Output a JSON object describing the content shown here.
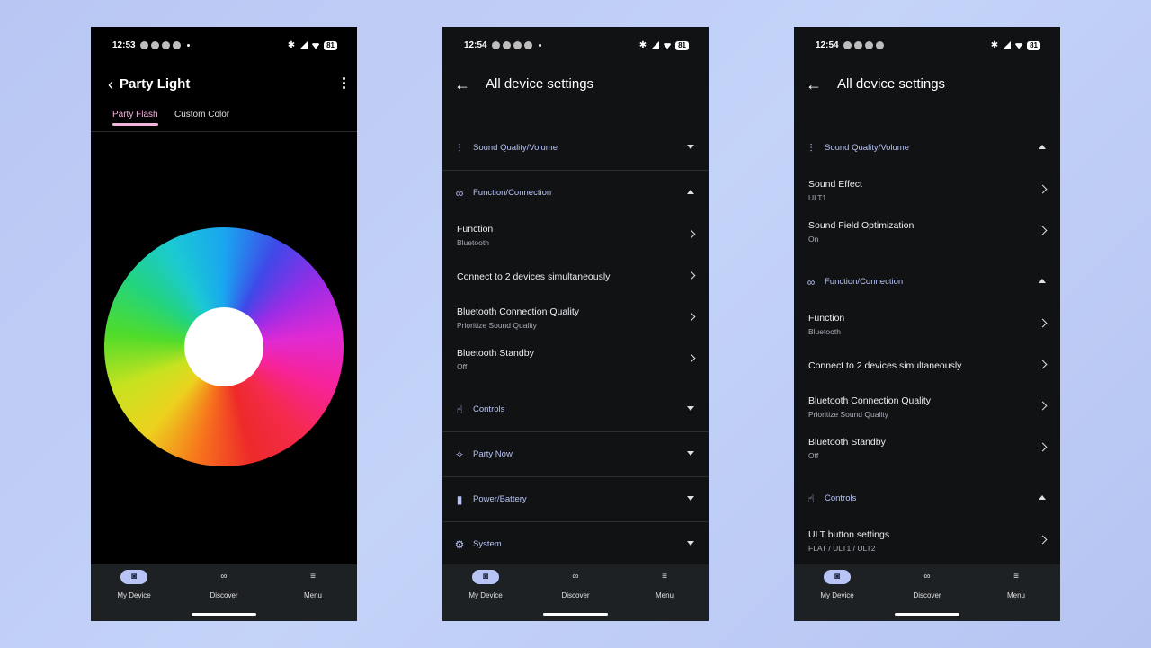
{
  "status": {
    "screen1_time": "12:53",
    "screen2_time": "12:54",
    "screen3_time": "12:54",
    "battery": "81",
    "bluetooth_glyph": "✱"
  },
  "screen1": {
    "title": "Party Light",
    "tabs": [
      {
        "label": "Party Flash",
        "active": true
      },
      {
        "label": "Custom Color",
        "active": false
      }
    ]
  },
  "screen2": {
    "title": "All device settings",
    "sections": [
      {
        "icon": "sound-wave-icon",
        "label": "Sound Quality/Volume",
        "expanded": false
      },
      {
        "icon": "link-icon",
        "label": "Function/Connection",
        "expanded": true,
        "rows": [
          {
            "title": "Function",
            "subtitle": "Bluetooth"
          },
          {
            "title": "Connect to 2 devices simultaneously",
            "subtitle": ""
          },
          {
            "title": "Bluetooth Connection Quality",
            "subtitle": "Prioritize Sound Quality"
          },
          {
            "title": "Bluetooth Standby",
            "subtitle": "Off"
          }
        ]
      },
      {
        "icon": "touch-icon",
        "label": "Controls",
        "expanded": false
      },
      {
        "icon": "party-popper-icon",
        "label": "Party Now",
        "expanded": false
      },
      {
        "icon": "battery-icon",
        "label": "Power/Battery",
        "expanded": false
      },
      {
        "icon": "gear-icon",
        "label": "System",
        "expanded": false
      }
    ]
  },
  "screen3": {
    "title": "All device settings",
    "sections": [
      {
        "icon": "sound-wave-icon",
        "label": "Sound Quality/Volume",
        "expanded": true,
        "rows": [
          {
            "title": "Sound Effect",
            "subtitle": "ULT1"
          },
          {
            "title": "Sound Field Optimization",
            "subtitle": "On"
          }
        ]
      },
      {
        "icon": "link-icon",
        "label": "Function/Connection",
        "expanded": true,
        "rows": [
          {
            "title": "Function",
            "subtitle": "Bluetooth"
          },
          {
            "title": "Connect to 2 devices simultaneously",
            "subtitle": ""
          },
          {
            "title": "Bluetooth Connection Quality",
            "subtitle": "Prioritize Sound Quality"
          },
          {
            "title": "Bluetooth Standby",
            "subtitle": "Off"
          }
        ]
      },
      {
        "icon": "touch-icon",
        "label": "Controls",
        "expanded": true,
        "rows": [
          {
            "title": "ULT button settings",
            "subtitle": "FLAT / ULT1 / ULT2"
          }
        ]
      }
    ]
  },
  "nav": {
    "my_device": "My Device",
    "discover": "Discover",
    "menu": "Menu"
  },
  "colors": {
    "accent": "#b8c4f5",
    "tab_active": "#f1b6dc",
    "background": "#101214"
  }
}
